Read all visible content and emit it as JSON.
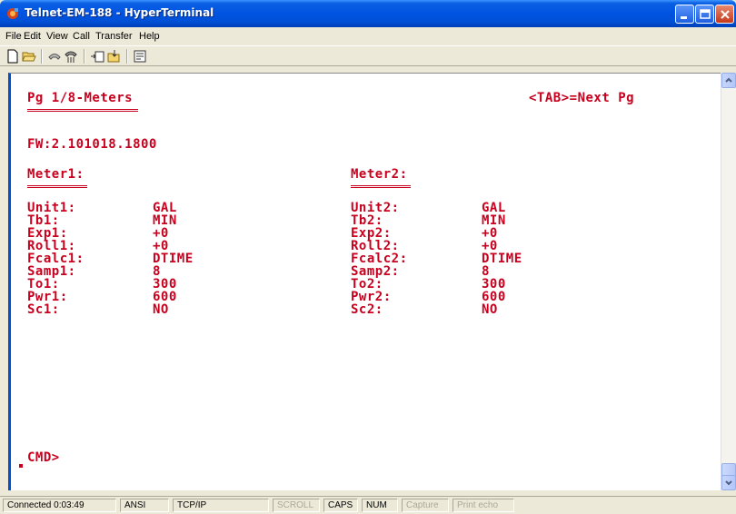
{
  "window": {
    "title": "Telnet-EM-188 - HyperTerminal"
  },
  "menu": [
    "File",
    "Edit",
    "View",
    "Call",
    "Transfer",
    "Help"
  ],
  "toolbar": [
    "new-icon",
    "open-icon",
    "disconnect-icon",
    "dial-icon",
    "send-icon",
    "receive-icon",
    "properties-icon"
  ],
  "terminal": {
    "page_title": "Pg 1/8-Meters",
    "next_hint": "<TAB>=Next Pg",
    "firmware": "FW:2.101018.1800",
    "meter1": {
      "header": "Meter1:",
      "labels": [
        "Unit1:",
        "Tb1:",
        "Exp1:",
        "Roll1:",
        "Fcalc1:",
        "Samp1:",
        "To1:",
        "Pwr1:",
        "Sc1:"
      ],
      "values": [
        "GAL",
        "MIN",
        "+0",
        "+0",
        "DTIME",
        "8",
        "300",
        "600",
        "NO"
      ]
    },
    "meter2": {
      "header": "Meter2:",
      "labels": [
        "Unit2:",
        "Tb2:",
        "Exp2:",
        "Roll2:",
        "Fcalc2:",
        "Samp2:",
        "To2:",
        "Pwr2:",
        "Sc2:"
      ],
      "values": [
        "GAL",
        "MIN",
        "+0",
        "+0",
        "DTIME",
        "8",
        "300",
        "600",
        "NO"
      ]
    },
    "prompt": "CMD>"
  },
  "status": {
    "connected": "Connected 0:03:49",
    "emulation": "ANSI",
    "protocol": "TCP/IP",
    "scroll": "SCROLL",
    "caps": "CAPS",
    "num": "NUM",
    "capture": "Capture",
    "print_echo": "Print echo"
  },
  "colors": {
    "terminal_text": "#c8001e",
    "titlebar": "#0053e1"
  }
}
